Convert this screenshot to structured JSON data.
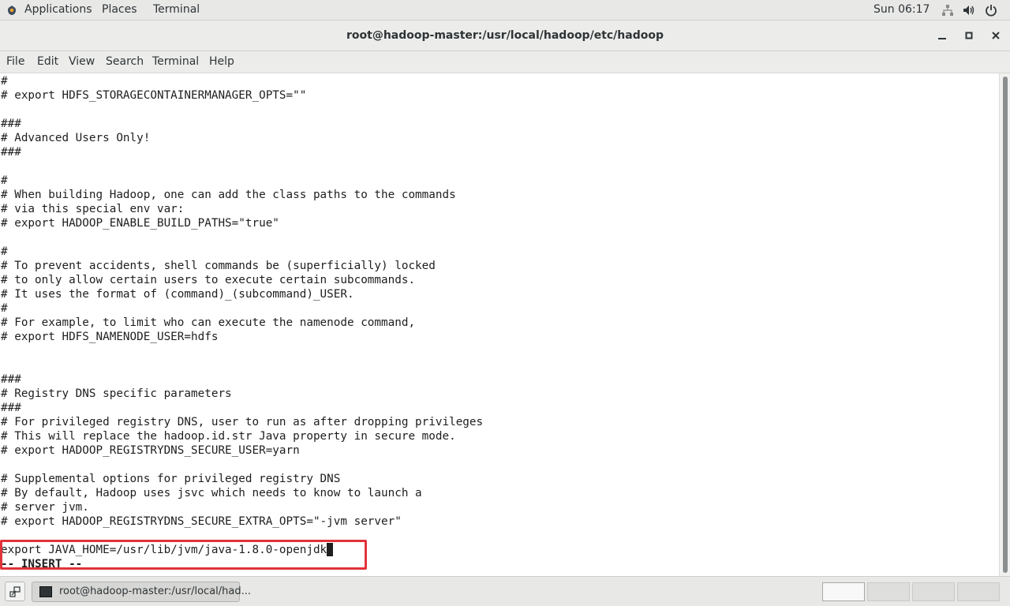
{
  "topbar": {
    "applications": "Applications",
    "places": "Places",
    "terminal": "Terminal",
    "clock": "Sun 06:17",
    "tray_icons": [
      "network-icon",
      "volume-icon",
      "power-icon"
    ]
  },
  "window": {
    "title": "root@hadoop-master:/usr/local/hadoop/etc/hadoop"
  },
  "menubar": {
    "file": "File",
    "edit": "Edit",
    "view": "View",
    "search": "Search",
    "terminal": "Terminal",
    "help": "Help"
  },
  "terminal": {
    "lines": [
      "#",
      "# export HDFS_STORAGECONTAINERMANAGER_OPTS=\"\"",
      "",
      "###",
      "# Advanced Users Only!",
      "###",
      "",
      "#",
      "# When building Hadoop, one can add the class paths to the commands",
      "# via this special env var:",
      "# export HADOOP_ENABLE_BUILD_PATHS=\"true\"",
      "",
      "#",
      "# To prevent accidents, shell commands be (superficially) locked",
      "# to only allow certain users to execute certain subcommands.",
      "# It uses the format of (command)_(subcommand)_USER.",
      "#",
      "# For example, to limit who can execute the namenode command,",
      "# export HDFS_NAMENODE_USER=hdfs",
      "",
      "",
      "###",
      "# Registry DNS specific parameters",
      "###",
      "# For privileged registry DNS, user to run as after dropping privileges",
      "# This will replace the hadoop.id.str Java property in secure mode.",
      "# export HADOOP_REGISTRYDNS_SECURE_USER=yarn",
      "",
      "# Supplemental options for privileged registry DNS",
      "# By default, Hadoop uses jsvc which needs to know to launch a",
      "# server jvm.",
      "# export HADOOP_REGISTRYDNS_SECURE_EXTRA_OPTS=\"-jvm server\"",
      "",
      "export JAVA_HOME=/usr/lib/jvm/java-1.8.0-openjdk"
    ],
    "mode": "-- INSERT --"
  },
  "taskbar": {
    "task_label": "root@hadoop-master:/usr/local/had..."
  }
}
